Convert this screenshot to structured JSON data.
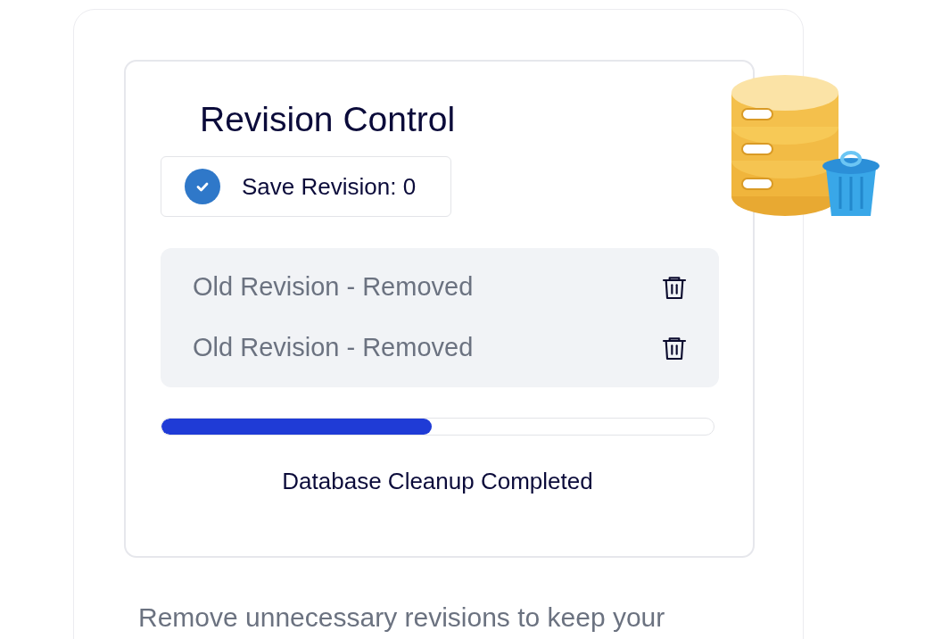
{
  "card": {
    "title": "Revision Control",
    "save_option": {
      "label": "Save Revision: 0",
      "checked": true
    },
    "removed_items": [
      {
        "label": "Old Revision - Removed"
      },
      {
        "label": "Old Revision - Removed"
      }
    ],
    "progress": {
      "level": 0.49,
      "caption": "Database Cleanup Completed"
    }
  },
  "description": "Remove unnecessary revisions to keep your"
}
